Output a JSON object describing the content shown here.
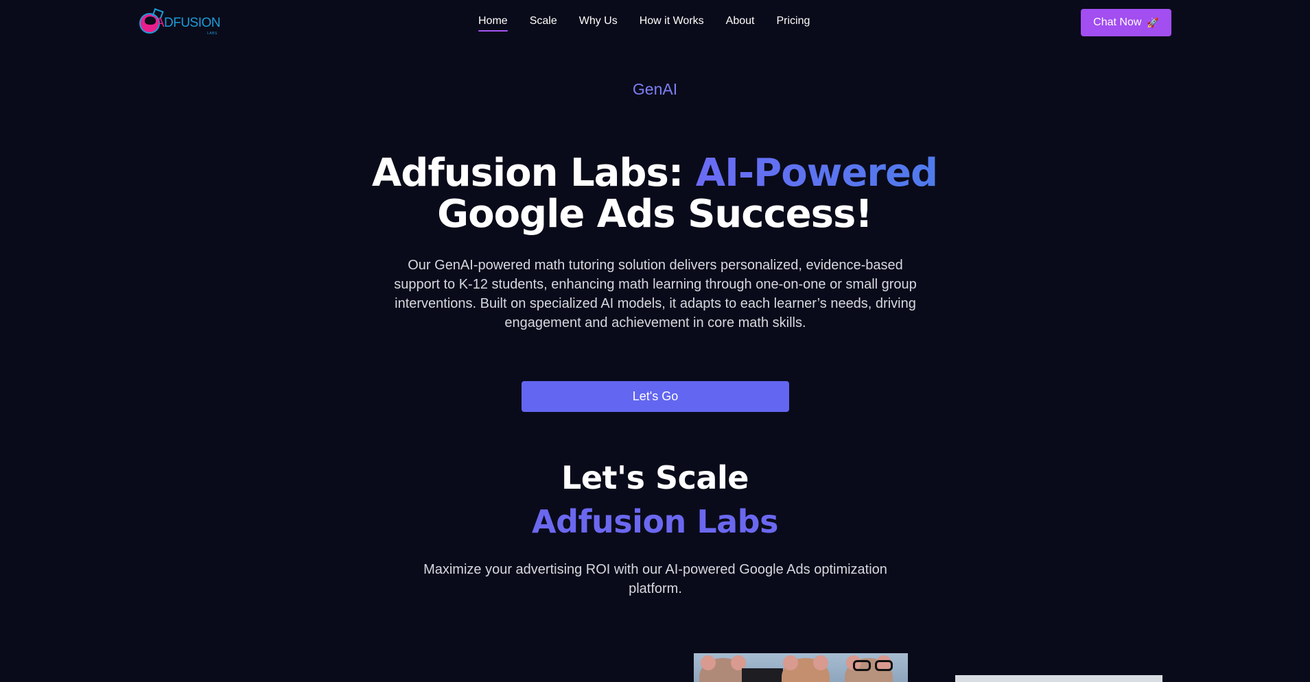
{
  "brand": {
    "logo_text_first": "A",
    "logo_text_rest": "DFUSION",
    "logo_sub": "LABS"
  },
  "nav": {
    "items": [
      {
        "label": "Home",
        "active": true
      },
      {
        "label": "Scale",
        "active": false
      },
      {
        "label": "Why Us",
        "active": false
      },
      {
        "label": "How it Works",
        "active": false
      },
      {
        "label": "About",
        "active": false
      },
      {
        "label": "Pricing",
        "active": false
      }
    ],
    "cta_label": "Chat Now",
    "cta_icon": "rocket-icon"
  },
  "hero": {
    "eyebrow": "GenAI",
    "title_part1": "Adfusion Labs: ",
    "title_accent": "AI-Powered",
    "title_part2": "Google Ads Success!",
    "description": "Our GenAI-powered math tutoring solution delivers personalized, evidence-based support to K-12 students, enhancing math learning through one-on-one or small group interventions. Built on specialized AI models, it adapts to each learner’s needs, driving engagement and achievement in core math skills.",
    "button_label": "Let's Go"
  },
  "scale": {
    "title": "Let's Scale",
    "subtitle": "Adfusion Labs",
    "description": "Maximize your advertising ROI with our AI-powered Google Ads optimization platform."
  },
  "colors": {
    "background": "#0a0b1a",
    "accent": "#6366f1",
    "chat_button": "#a24ef0",
    "eyebrow": "#7b7ff5",
    "nav_underline": "#a855f7"
  }
}
